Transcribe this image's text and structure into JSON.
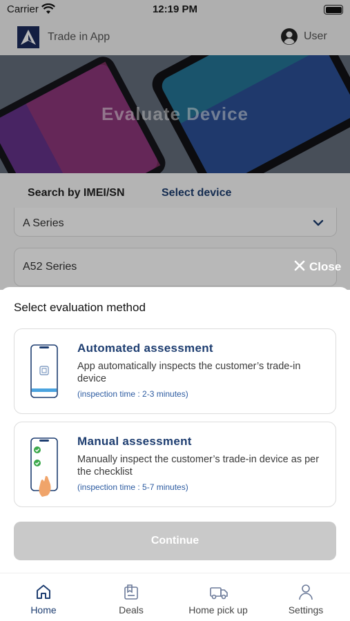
{
  "status_bar": {
    "carrier": "Carrier",
    "time": "12:19 PM"
  },
  "header": {
    "app_title": "Trade in App",
    "user_label": "User"
  },
  "hero": {
    "title": "Evaluate Device"
  },
  "tabs": [
    {
      "label": "Search by IMEI/SN"
    },
    {
      "label": "Select device"
    }
  ],
  "fields": {
    "series": "A Series",
    "model": "A52 Series"
  },
  "close_label": "Close",
  "sheet": {
    "title": "Select evaluation method",
    "methods": [
      {
        "title": "Automated assessment",
        "description": "App automatically inspects the customer’s trade-in device",
        "time": "(inspection time : 2-3 minutes)"
      },
      {
        "title": "Manual assessment",
        "description": "Manually inspect the customer’s trade-in device as per the checklist",
        "time": "(inspection time : 5-7 minutes)"
      }
    ],
    "continue_label": "Continue"
  },
  "nav": [
    {
      "label": "Home",
      "icon": "home-icon"
    },
    {
      "label": "Deals",
      "icon": "deals-icon"
    },
    {
      "label": "Home pick up",
      "icon": "truck-icon"
    },
    {
      "label": "Settings",
      "icon": "person-icon"
    }
  ],
  "colors": {
    "primary": "#1d3d70",
    "link": "#2b5aa0",
    "disabled": "#c9c9c9",
    "green": "#3aa84a"
  }
}
